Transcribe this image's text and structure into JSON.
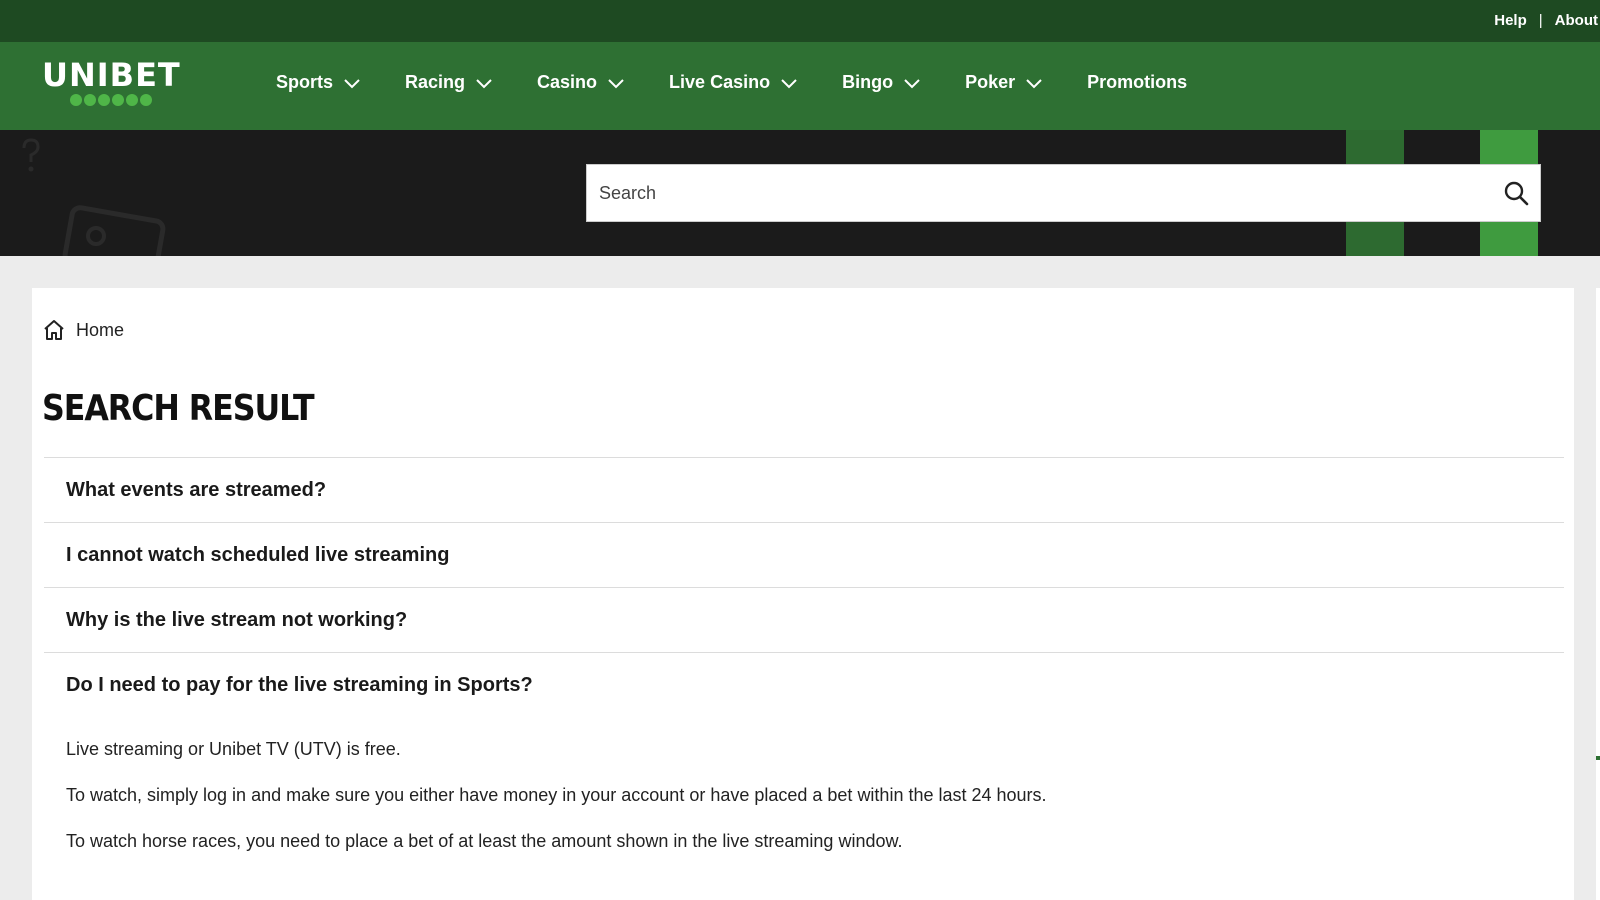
{
  "topbar": {
    "help": "Help",
    "separator": "|",
    "about": "About"
  },
  "brand": {
    "logo_text": "UNIBET",
    "accent": "#2e7033",
    "dark_accent": "#1e4a22",
    "dot_color": "#4fb648"
  },
  "nav": {
    "items": [
      {
        "label": "Sports",
        "dropdown": true
      },
      {
        "label": "Racing",
        "dropdown": true
      },
      {
        "label": "Casino",
        "dropdown": true
      },
      {
        "label": "Live Casino",
        "dropdown": true
      },
      {
        "label": "Bingo",
        "dropdown": true
      },
      {
        "label": "Poker",
        "dropdown": true
      },
      {
        "label": "Promotions",
        "dropdown": false
      }
    ]
  },
  "search": {
    "placeholder": "Search",
    "icon": "search-icon"
  },
  "breadcrumb": {
    "home_label": "Home",
    "icon": "home-icon"
  },
  "page": {
    "title": "SEARCH RESULT"
  },
  "results": [
    {
      "question": "What events are streamed?"
    },
    {
      "question": "I cannot watch scheduled live streaming"
    },
    {
      "question": "Why is the live stream not working?"
    },
    {
      "question": "Do I need to pay for the live streaming in Sports?"
    }
  ],
  "answer": {
    "paragraphs": [
      "Live streaming or Unibet TV (UTV) is free.",
      "To watch, simply log in and make sure you either have money in your account or have placed a bet within the last 24 hours.",
      "To watch horse races, you need to place a bet of at least the amount shown in the live streaming window."
    ]
  }
}
